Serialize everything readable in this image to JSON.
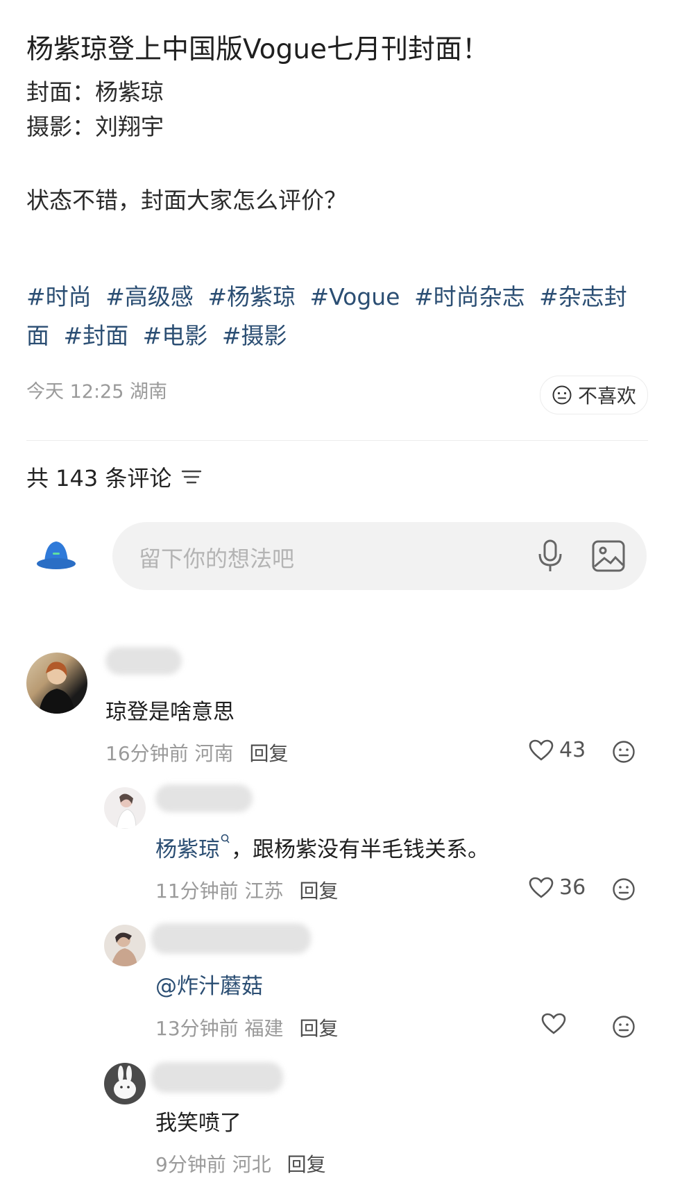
{
  "post": {
    "title": "杨紫琼登上中国版Vogue七月刊封面！",
    "cover_line": "封面：杨紫琼",
    "photo_line": "摄影：刘翔宇",
    "body": "状态不错，封面大家怎么评价？",
    "tags": [
      "#时尚",
      "#高级感",
      "#杨紫琼",
      "#Vogue",
      "#时尚杂志",
      "#杂志封面",
      "#封面",
      "#电影",
      "#摄影"
    ],
    "time_location": "今天 12:25 湖南",
    "dislike_label": "不喜欢"
  },
  "comments_header": {
    "count_label": "共 143 条评论"
  },
  "composer": {
    "placeholder": "留下你的想法吧"
  },
  "comments": [
    {
      "text": "琼登是啥意思",
      "time": "16分钟前",
      "location": "河南",
      "reply": "回复",
      "likes": "43"
    },
    {
      "mention": "杨紫琼",
      "text": "，跟杨紫没有半毛钱关系。",
      "time": "11分钟前",
      "location": "江苏",
      "reply": "回复",
      "likes": "36"
    },
    {
      "text": "@炸汁蘑菇",
      "time": "13分钟前",
      "location": "福建",
      "reply": "回复",
      "likes": ""
    },
    {
      "text": "我笑喷了",
      "time": "9分钟前",
      "location": "河北",
      "reply": "回复"
    }
  ],
  "colors": {
    "link": "#2b4e73",
    "meta": "#9a9a9a",
    "input_bg": "#f2f2f2"
  }
}
